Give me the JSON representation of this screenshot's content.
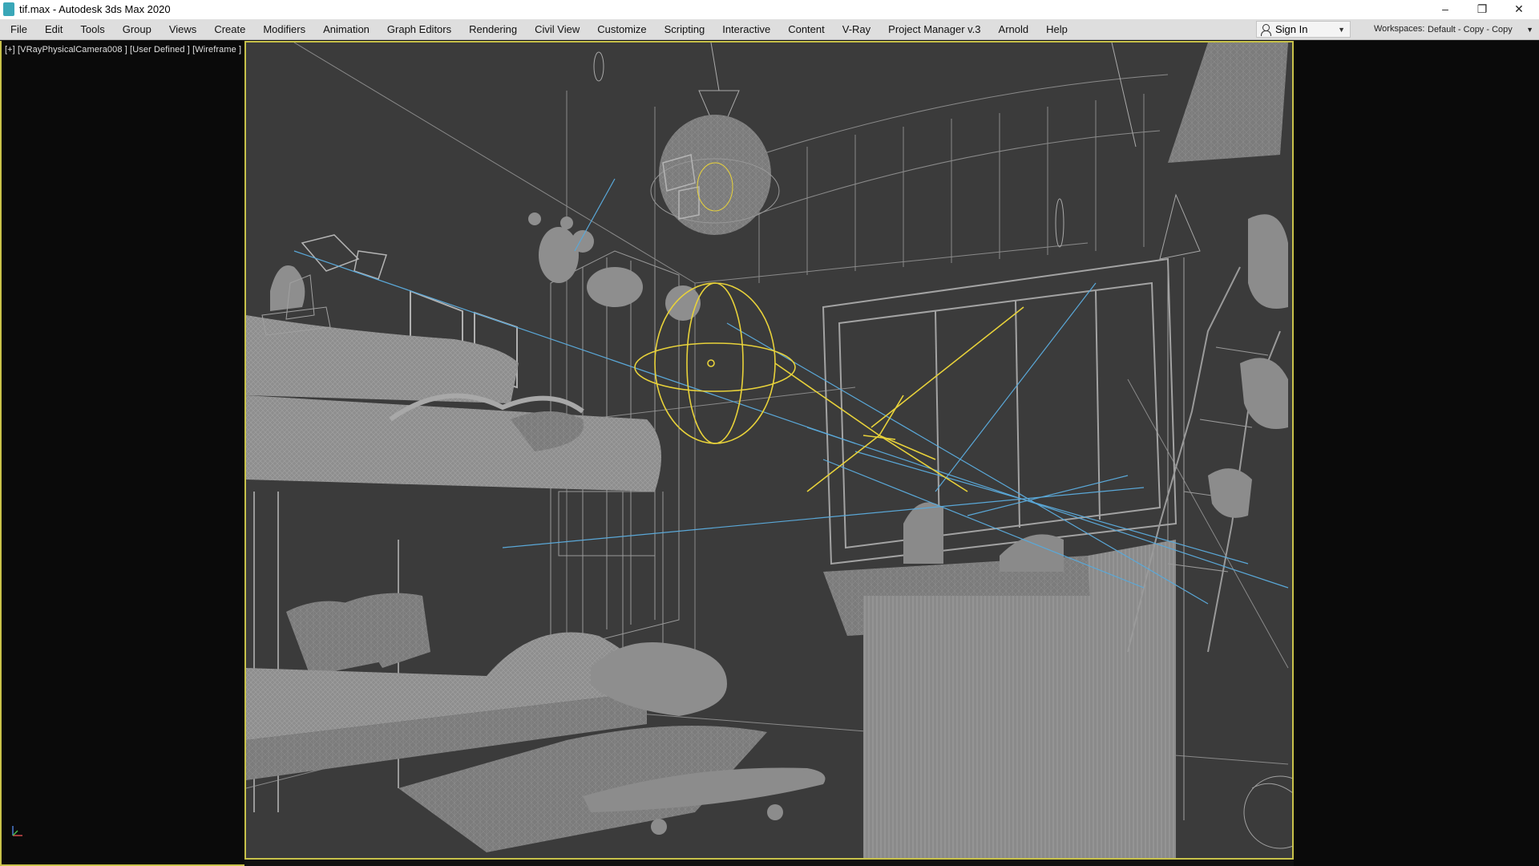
{
  "window": {
    "title": "tif.max - Autodesk 3ds Max 2020",
    "app_icon": "3ds-max-icon",
    "controls": {
      "minimize": "–",
      "maximize": "❐",
      "close": "✕"
    }
  },
  "menubar": {
    "items": [
      "File",
      "Edit",
      "Tools",
      "Group",
      "Views",
      "Create",
      "Modifiers",
      "Animation",
      "Graph Editors",
      "Rendering",
      "Civil View",
      "Customize",
      "Scripting",
      "Interactive",
      "Content",
      "V-Ray",
      "Project Manager v.3",
      "Arnold",
      "Help"
    ],
    "sign_in": {
      "label": "Sign In",
      "icon": "user-icon"
    },
    "workspaces_label": "Workspaces:",
    "workspace_value": "Default - Copy - Copy"
  },
  "viewport": {
    "label": "[+] [VRayPhysicalCamera008 ] [User Defined ] [Wireframe ]",
    "axis_gizmo": "xyz-axis-icon",
    "colors": {
      "background": "#3b3b3b",
      "geometry": "#9a9a9a",
      "selection": "#e8d23a",
      "target_lines": "#5aa8d8",
      "border": "#c8c24a"
    }
  }
}
